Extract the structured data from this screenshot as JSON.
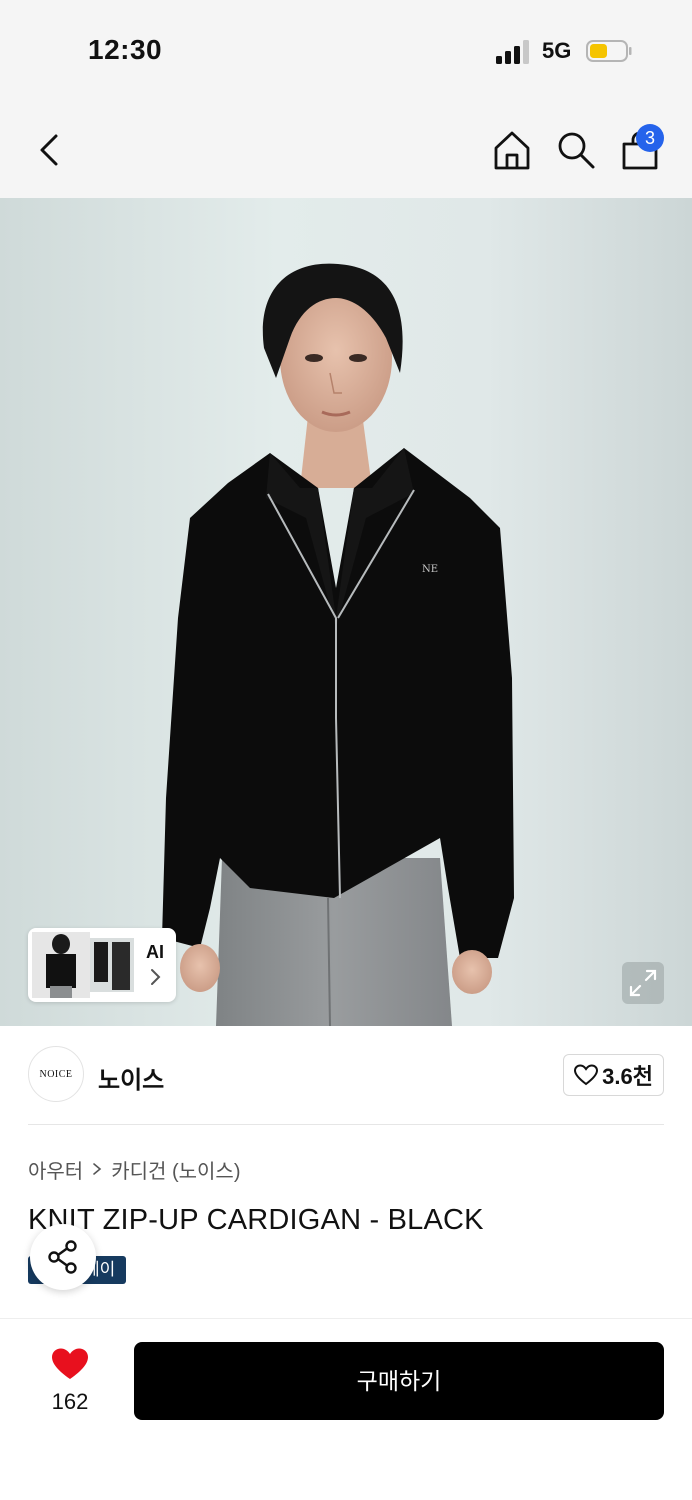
{
  "status_bar": {
    "time": "12:30",
    "network": "5G",
    "signal_bars": 3,
    "battery_level": 0.5,
    "battery_color": "#f5c400"
  },
  "nav": {
    "icons": [
      "back-arrow-icon",
      "home-icon",
      "search-icon",
      "shopping-bag-icon"
    ],
    "cart_badge": "3",
    "badge_color": "#2563eb"
  },
  "hero": {
    "ai_chip_label": "AI",
    "thumbnail_logo": "NE"
  },
  "brand": {
    "logo_text": "NOICE",
    "name": "노이스",
    "likes": "3.6천"
  },
  "breadcrumb": {
    "category": "아우터",
    "subcategory": "카디건 (노이스)"
  },
  "product": {
    "title": "KNIT ZIP-UP CARDIGAN - BLACK",
    "pay_badge_visible": "페이"
  },
  "bottom_bar": {
    "wish_count": "162",
    "buy_label": "구매하기",
    "heart_color": "#e8101e"
  }
}
